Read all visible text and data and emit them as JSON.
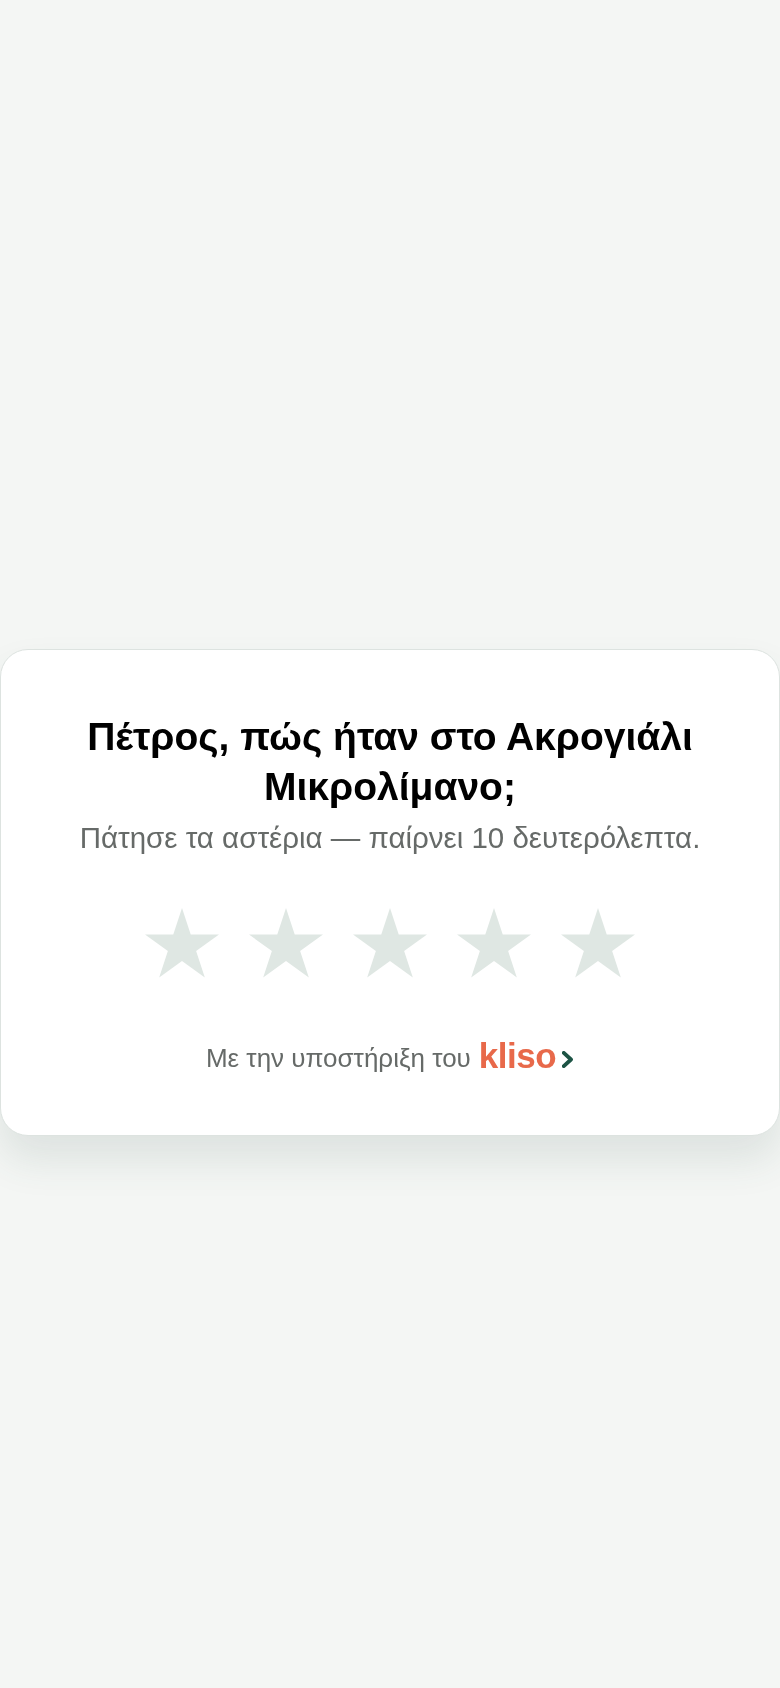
{
  "card": {
    "title": "Πέτρος, πώς ήταν στο Ακρογιάλι Μικρολίμανο;",
    "subtitle": "Πάτησε τα αστέρια — παίρνει 10 δευτερόλεπτα."
  },
  "rating": {
    "stars": 0
  },
  "footer": {
    "text": "Με την υποστήριξη του",
    "brand": "kliso"
  }
}
